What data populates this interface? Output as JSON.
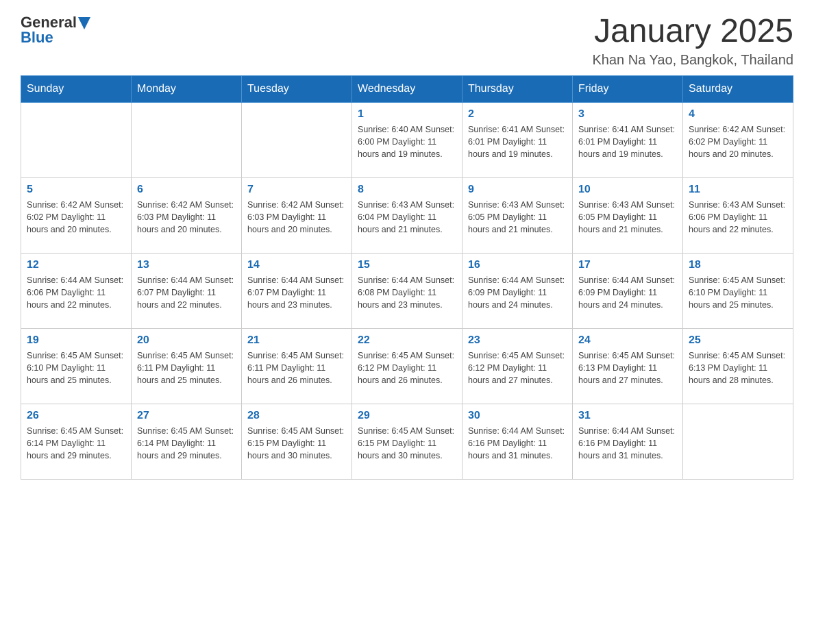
{
  "header": {
    "logo_general": "General",
    "logo_blue": "Blue",
    "month_title": "January 2025",
    "location": "Khan Na Yao, Bangkok, Thailand"
  },
  "days_of_week": [
    "Sunday",
    "Monday",
    "Tuesday",
    "Wednesday",
    "Thursday",
    "Friday",
    "Saturday"
  ],
  "weeks": [
    {
      "days": [
        {
          "number": "",
          "info": ""
        },
        {
          "number": "",
          "info": ""
        },
        {
          "number": "",
          "info": ""
        },
        {
          "number": "1",
          "info": "Sunrise: 6:40 AM\nSunset: 6:00 PM\nDaylight: 11 hours\nand 19 minutes."
        },
        {
          "number": "2",
          "info": "Sunrise: 6:41 AM\nSunset: 6:01 PM\nDaylight: 11 hours\nand 19 minutes."
        },
        {
          "number": "3",
          "info": "Sunrise: 6:41 AM\nSunset: 6:01 PM\nDaylight: 11 hours\nand 19 minutes."
        },
        {
          "number": "4",
          "info": "Sunrise: 6:42 AM\nSunset: 6:02 PM\nDaylight: 11 hours\nand 20 minutes."
        }
      ]
    },
    {
      "days": [
        {
          "number": "5",
          "info": "Sunrise: 6:42 AM\nSunset: 6:02 PM\nDaylight: 11 hours\nand 20 minutes."
        },
        {
          "number": "6",
          "info": "Sunrise: 6:42 AM\nSunset: 6:03 PM\nDaylight: 11 hours\nand 20 minutes."
        },
        {
          "number": "7",
          "info": "Sunrise: 6:42 AM\nSunset: 6:03 PM\nDaylight: 11 hours\nand 20 minutes."
        },
        {
          "number": "8",
          "info": "Sunrise: 6:43 AM\nSunset: 6:04 PM\nDaylight: 11 hours\nand 21 minutes."
        },
        {
          "number": "9",
          "info": "Sunrise: 6:43 AM\nSunset: 6:05 PM\nDaylight: 11 hours\nand 21 minutes."
        },
        {
          "number": "10",
          "info": "Sunrise: 6:43 AM\nSunset: 6:05 PM\nDaylight: 11 hours\nand 21 minutes."
        },
        {
          "number": "11",
          "info": "Sunrise: 6:43 AM\nSunset: 6:06 PM\nDaylight: 11 hours\nand 22 minutes."
        }
      ]
    },
    {
      "days": [
        {
          "number": "12",
          "info": "Sunrise: 6:44 AM\nSunset: 6:06 PM\nDaylight: 11 hours\nand 22 minutes."
        },
        {
          "number": "13",
          "info": "Sunrise: 6:44 AM\nSunset: 6:07 PM\nDaylight: 11 hours\nand 22 minutes."
        },
        {
          "number": "14",
          "info": "Sunrise: 6:44 AM\nSunset: 6:07 PM\nDaylight: 11 hours\nand 23 minutes."
        },
        {
          "number": "15",
          "info": "Sunrise: 6:44 AM\nSunset: 6:08 PM\nDaylight: 11 hours\nand 23 minutes."
        },
        {
          "number": "16",
          "info": "Sunrise: 6:44 AM\nSunset: 6:09 PM\nDaylight: 11 hours\nand 24 minutes."
        },
        {
          "number": "17",
          "info": "Sunrise: 6:44 AM\nSunset: 6:09 PM\nDaylight: 11 hours\nand 24 minutes."
        },
        {
          "number": "18",
          "info": "Sunrise: 6:45 AM\nSunset: 6:10 PM\nDaylight: 11 hours\nand 25 minutes."
        }
      ]
    },
    {
      "days": [
        {
          "number": "19",
          "info": "Sunrise: 6:45 AM\nSunset: 6:10 PM\nDaylight: 11 hours\nand 25 minutes."
        },
        {
          "number": "20",
          "info": "Sunrise: 6:45 AM\nSunset: 6:11 PM\nDaylight: 11 hours\nand 25 minutes."
        },
        {
          "number": "21",
          "info": "Sunrise: 6:45 AM\nSunset: 6:11 PM\nDaylight: 11 hours\nand 26 minutes."
        },
        {
          "number": "22",
          "info": "Sunrise: 6:45 AM\nSunset: 6:12 PM\nDaylight: 11 hours\nand 26 minutes."
        },
        {
          "number": "23",
          "info": "Sunrise: 6:45 AM\nSunset: 6:12 PM\nDaylight: 11 hours\nand 27 minutes."
        },
        {
          "number": "24",
          "info": "Sunrise: 6:45 AM\nSunset: 6:13 PM\nDaylight: 11 hours\nand 27 minutes."
        },
        {
          "number": "25",
          "info": "Sunrise: 6:45 AM\nSunset: 6:13 PM\nDaylight: 11 hours\nand 28 minutes."
        }
      ]
    },
    {
      "days": [
        {
          "number": "26",
          "info": "Sunrise: 6:45 AM\nSunset: 6:14 PM\nDaylight: 11 hours\nand 29 minutes."
        },
        {
          "number": "27",
          "info": "Sunrise: 6:45 AM\nSunset: 6:14 PM\nDaylight: 11 hours\nand 29 minutes."
        },
        {
          "number": "28",
          "info": "Sunrise: 6:45 AM\nSunset: 6:15 PM\nDaylight: 11 hours\nand 30 minutes."
        },
        {
          "number": "29",
          "info": "Sunrise: 6:45 AM\nSunset: 6:15 PM\nDaylight: 11 hours\nand 30 minutes."
        },
        {
          "number": "30",
          "info": "Sunrise: 6:44 AM\nSunset: 6:16 PM\nDaylight: 11 hours\nand 31 minutes."
        },
        {
          "number": "31",
          "info": "Sunrise: 6:44 AM\nSunset: 6:16 PM\nDaylight: 11 hours\nand 31 minutes."
        },
        {
          "number": "",
          "info": ""
        }
      ]
    }
  ]
}
